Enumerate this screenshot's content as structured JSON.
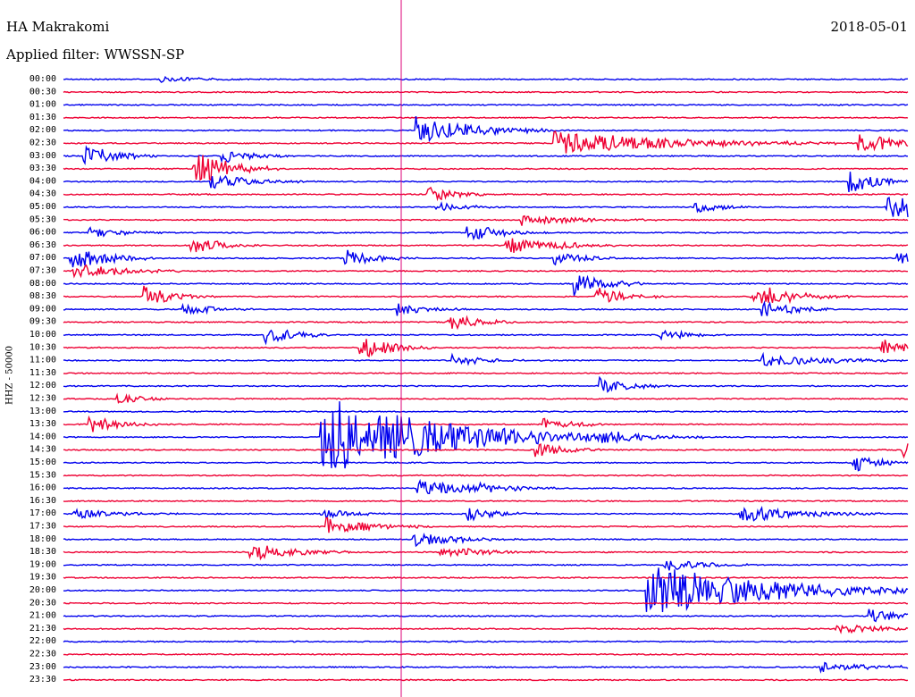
{
  "header": {
    "station": "HA Makrakomi",
    "date": "2018-05-01",
    "filter": "Applied filter: WWSSN-SP",
    "ylabel": "HHZ - 50000"
  },
  "colors": {
    "blue": "#0000ee",
    "red": "#ee0033",
    "marker": "#dd0077"
  },
  "chart_data": {
    "type": "line",
    "title": "HA Makrakomi",
    "subtitle": "Applied filter: WWSSN-SP",
    "ylabel": "HHZ - 50000",
    "rows": [
      "00:00",
      "00:30",
      "01:00",
      "01:30",
      "02:00",
      "02:30",
      "03:00",
      "03:30",
      "04:00",
      "04:30",
      "05:00",
      "05:30",
      "06:00",
      "06:30",
      "07:00",
      "07:30",
      "08:00",
      "08:30",
      "09:00",
      "09:30",
      "10:00",
      "10:30",
      "11:00",
      "11:30",
      "12:00",
      "12:30",
      "13:00",
      "13:30",
      "14:00",
      "14:30",
      "15:00",
      "15:30",
      "16:00",
      "16:30",
      "17:00",
      "17:30",
      "18:00",
      "18:30",
      "19:00",
      "19:30",
      "20:00",
      "20:30",
      "21:00",
      "21:30",
      "22:00",
      "22:30",
      "23:00",
      "23:30"
    ],
    "row_minutes": 30,
    "marker_minute": 12,
    "events": [
      {
        "row": 0,
        "minute": 3.5,
        "amp": 3,
        "dur": 1.5
      },
      {
        "row": 4,
        "minute": 12.6,
        "amp": 16,
        "dur": 2
      },
      {
        "row": 5,
        "minute": 17.5,
        "amp": 14,
        "dur": 4
      },
      {
        "row": 5,
        "minute": 28.3,
        "amp": 12,
        "dur": 1.5
      },
      {
        "row": 6,
        "minute": 0.8,
        "amp": 14,
        "dur": 1
      },
      {
        "row": 6,
        "minute": 5.7,
        "amp": 8,
        "dur": 1
      },
      {
        "row": 7,
        "minute": 4.7,
        "amp": 22,
        "dur": 1.2
      },
      {
        "row": 8,
        "minute": 5.3,
        "amp": 8,
        "dur": 1.5
      },
      {
        "row": 8,
        "minute": 28,
        "amp": 12,
        "dur": 1.2
      },
      {
        "row": 9,
        "minute": 13,
        "amp": 8,
        "dur": 1
      },
      {
        "row": 10,
        "minute": 13.3,
        "amp": 5,
        "dur": 1
      },
      {
        "row": 10,
        "minute": 22.5,
        "amp": 7,
        "dur": 0.8
      },
      {
        "row": 10,
        "minute": 29.3,
        "amp": 14,
        "dur": 3
      },
      {
        "row": 11,
        "minute": 16.3,
        "amp": 6,
        "dur": 2
      },
      {
        "row": 12,
        "minute": 1.0,
        "amp": 6,
        "dur": 1
      },
      {
        "row": 12,
        "minute": 14.4,
        "amp": 10,
        "dur": 1.2
      },
      {
        "row": 13,
        "minute": 4.6,
        "amp": 10,
        "dur": 1
      },
      {
        "row": 13,
        "minute": 15.8,
        "amp": 10,
        "dur": 1.2
      },
      {
        "row": 13,
        "minute": 17.4,
        "amp": 5,
        "dur": 1
      },
      {
        "row": 14,
        "minute": 0.3,
        "amp": 14,
        "dur": 1.2
      },
      {
        "row": 14,
        "minute": 10.1,
        "amp": 10,
        "dur": 1
      },
      {
        "row": 14,
        "minute": 17.5,
        "amp": 7,
        "dur": 1
      },
      {
        "row": 14,
        "minute": 29.7,
        "amp": 6,
        "dur": 1.5
      },
      {
        "row": 15,
        "minute": 0.4,
        "amp": 10,
        "dur": 1.5
      },
      {
        "row": 16,
        "minute": 18.2,
        "amp": 14,
        "dur": 1
      },
      {
        "row": 17,
        "minute": 2.9,
        "amp": 12,
        "dur": 1
      },
      {
        "row": 17,
        "minute": 19.0,
        "amp": 10,
        "dur": 1
      },
      {
        "row": 17,
        "minute": 24.5,
        "amp": 10,
        "dur": 1.5
      },
      {
        "row": 17,
        "minute": 25.0,
        "amp": 7,
        "dur": 1
      },
      {
        "row": 18,
        "minute": 4.3,
        "amp": 8,
        "dur": 1
      },
      {
        "row": 18,
        "minute": 11.9,
        "amp": 8,
        "dur": 1
      },
      {
        "row": 18,
        "minute": 24.9,
        "amp": 10,
        "dur": 1
      },
      {
        "row": 19,
        "minute": 13.7,
        "amp": 10,
        "dur": 1
      },
      {
        "row": 20,
        "minute": 7.2,
        "amp": 10,
        "dur": 1
      },
      {
        "row": 20,
        "minute": 21.2,
        "amp": 6,
        "dur": 1
      },
      {
        "row": 21,
        "minute": 10.6,
        "amp": 14,
        "dur": 1
      },
      {
        "row": 21,
        "minute": 29.1,
        "amp": 10,
        "dur": 1
      },
      {
        "row": 22,
        "minute": 13.9,
        "amp": 7,
        "dur": 1
      },
      {
        "row": 22,
        "minute": 24.9,
        "amp": 8,
        "dur": 2
      },
      {
        "row": 24,
        "minute": 19.1,
        "amp": 10,
        "dur": 1
      },
      {
        "row": 25,
        "minute": 2.0,
        "amp": 5,
        "dur": 1
      },
      {
        "row": 27,
        "minute": 1.0,
        "amp": 9,
        "dur": 1
      },
      {
        "row": 27,
        "minute": 17.1,
        "amp": 8,
        "dur": 1
      },
      {
        "row": 28,
        "minute": 9.2,
        "amp": 48,
        "dur": 4
      },
      {
        "row": 28,
        "minute": 19.1,
        "amp": 9,
        "dur": 1.5
      },
      {
        "row": 29,
        "minute": 16.8,
        "amp": 8,
        "dur": 1
      },
      {
        "row": 29,
        "minute": 29.9,
        "amp": 8,
        "dur": 1
      },
      {
        "row": 30,
        "minute": 28.1,
        "amp": 10,
        "dur": 1
      },
      {
        "row": 32,
        "minute": 12.6,
        "amp": 10,
        "dur": 2
      },
      {
        "row": 32,
        "minute": 14.7,
        "amp": 5,
        "dur": 1
      },
      {
        "row": 34,
        "minute": 0.4,
        "amp": 6,
        "dur": 1.5
      },
      {
        "row": 34,
        "minute": 9.2,
        "amp": 6,
        "dur": 1
      },
      {
        "row": 34,
        "minute": 14.4,
        "amp": 8,
        "dur": 1
      },
      {
        "row": 34,
        "minute": 24.1,
        "amp": 10,
        "dur": 2
      },
      {
        "row": 35,
        "minute": 9.4,
        "amp": 10,
        "dur": 1.5
      },
      {
        "row": 36,
        "minute": 12.5,
        "amp": 9,
        "dur": 1.5
      },
      {
        "row": 37,
        "minute": 6.7,
        "amp": 10,
        "dur": 1.5
      },
      {
        "row": 37,
        "minute": 13.4,
        "amp": 7,
        "dur": 1.5
      },
      {
        "row": 38,
        "minute": 21.4,
        "amp": 8,
        "dur": 1.2
      },
      {
        "row": 40,
        "minute": 20.8,
        "amp": 30,
        "dur": 4
      },
      {
        "row": 42,
        "minute": 28.7,
        "amp": 8,
        "dur": 1
      },
      {
        "row": 43,
        "minute": 27.5,
        "amp": 5,
        "dur": 2
      },
      {
        "row": 46,
        "minute": 27.0,
        "amp": 5,
        "dur": 2
      }
    ]
  }
}
